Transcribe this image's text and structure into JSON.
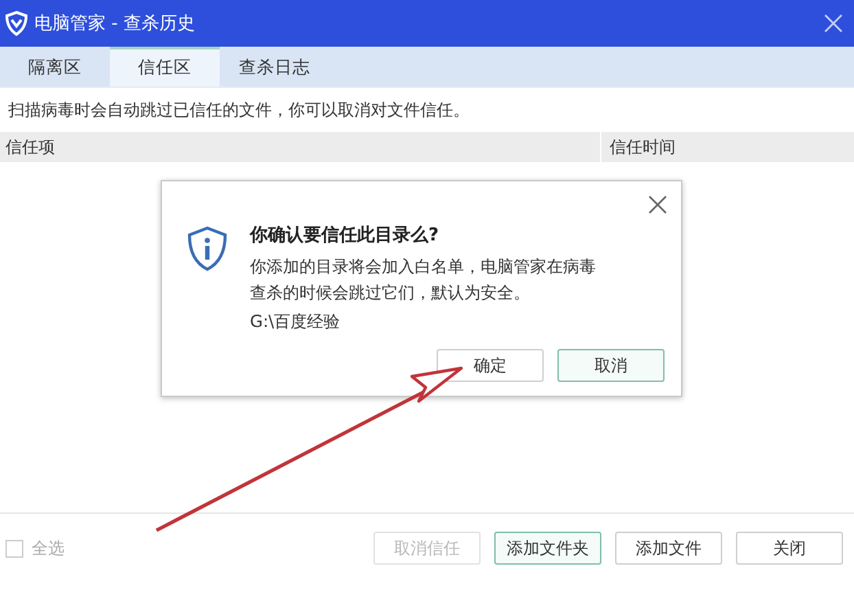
{
  "window": {
    "title": "电脑管家 - 查杀历史"
  },
  "tabs": [
    {
      "label": "隔离区",
      "selected": false
    },
    {
      "label": "信任区",
      "selected": true
    },
    {
      "label": "查杀日志",
      "selected": false
    }
  ],
  "description": "扫描病毒时会自动跳过已信任的文件，你可以取消对文件信任。",
  "table": {
    "columns": [
      "信任项",
      "信任时间"
    ]
  },
  "dialog": {
    "title": "你确认要信任此目录么?",
    "message": "你添加的目录将会加入白名单，电脑管家在病毒查杀的时候会跳过它们，默认为安全。",
    "path": "G:\\百度经验",
    "buttons": [
      {
        "label": "确定",
        "focused": false
      },
      {
        "label": "取消",
        "focused": true
      }
    ]
  },
  "footer": {
    "select_all": {
      "label": "全选",
      "checked": false,
      "disabled": true
    },
    "buttons": [
      {
        "label": "取消信任",
        "disabled": true,
        "focused": false
      },
      {
        "label": "添加文件夹",
        "disabled": false,
        "focused": true
      },
      {
        "label": "添加文件",
        "disabled": false,
        "focused": false
      },
      {
        "label": "关闭",
        "disabled": false,
        "focused": false
      }
    ]
  }
}
